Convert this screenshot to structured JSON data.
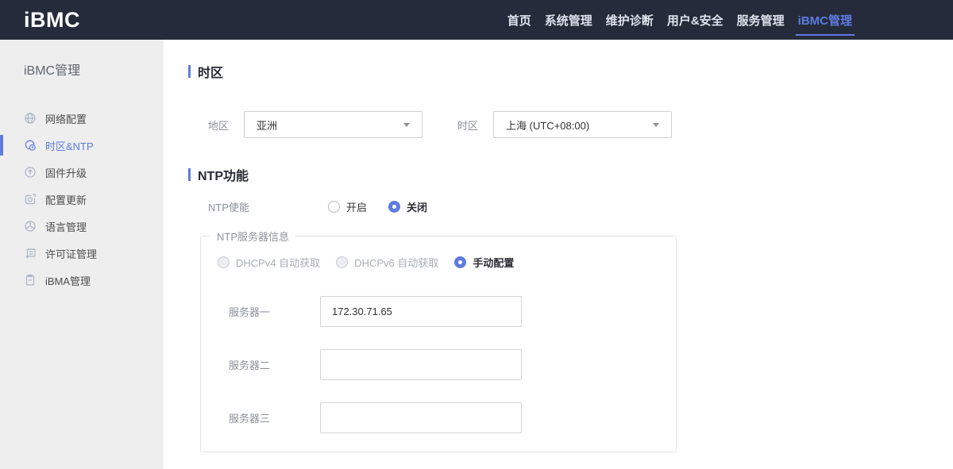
{
  "colors": {
    "accent": "#5e7ce0",
    "header_bg": "#252b3a",
    "sidebar_bg": "#eeeeee"
  },
  "header": {
    "logo": "iBMC",
    "nav": [
      {
        "label": "首页",
        "active": false
      },
      {
        "label": "系统管理",
        "active": false
      },
      {
        "label": "维护诊断",
        "active": false
      },
      {
        "label": "用户&安全",
        "active": false
      },
      {
        "label": "服务管理",
        "active": false
      },
      {
        "label": "iBMC管理",
        "active": true
      }
    ]
  },
  "sidebar": {
    "title": "iBMC管理",
    "items": [
      {
        "label": "网络配置",
        "icon": "globe-icon",
        "active": false
      },
      {
        "label": "时区&NTP",
        "icon": "timezone-clock-icon",
        "active": true
      },
      {
        "label": "固件升级",
        "icon": "upload-circle-icon",
        "active": false
      },
      {
        "label": "配置更新",
        "icon": "config-update-icon",
        "active": false
      },
      {
        "label": "语言管理",
        "icon": "language-globe-icon",
        "active": false
      },
      {
        "label": "许可证管理",
        "icon": "license-icon",
        "active": false
      },
      {
        "label": "iBMA管理",
        "icon": "clipboard-icon",
        "active": false
      }
    ]
  },
  "main": {
    "timezone_section": {
      "title": "时区",
      "region_label": "地区",
      "region_value": "亚洲",
      "timezone_label": "时区",
      "timezone_value": "上海 (UTC+08:00)"
    },
    "ntp_section": {
      "title": "NTP功能",
      "enable_label": "NTP使能",
      "enable_options": [
        {
          "label": "开启",
          "selected": false
        },
        {
          "label": "关闭",
          "selected": true
        }
      ],
      "server_group": {
        "legend": "NTP服务器信息",
        "mode_options": [
          {
            "label": "DHCPv4 自动获取",
            "selected": false,
            "disabled": true
          },
          {
            "label": "DHCPv6 自动获取",
            "selected": false,
            "disabled": true
          },
          {
            "label": "手动配置",
            "selected": true,
            "disabled": false
          }
        ],
        "servers": [
          {
            "label": "服务器一",
            "value": "172.30.71.65"
          },
          {
            "label": "服务器二",
            "value": ""
          },
          {
            "label": "服务器三",
            "value": ""
          }
        ]
      }
    }
  }
}
